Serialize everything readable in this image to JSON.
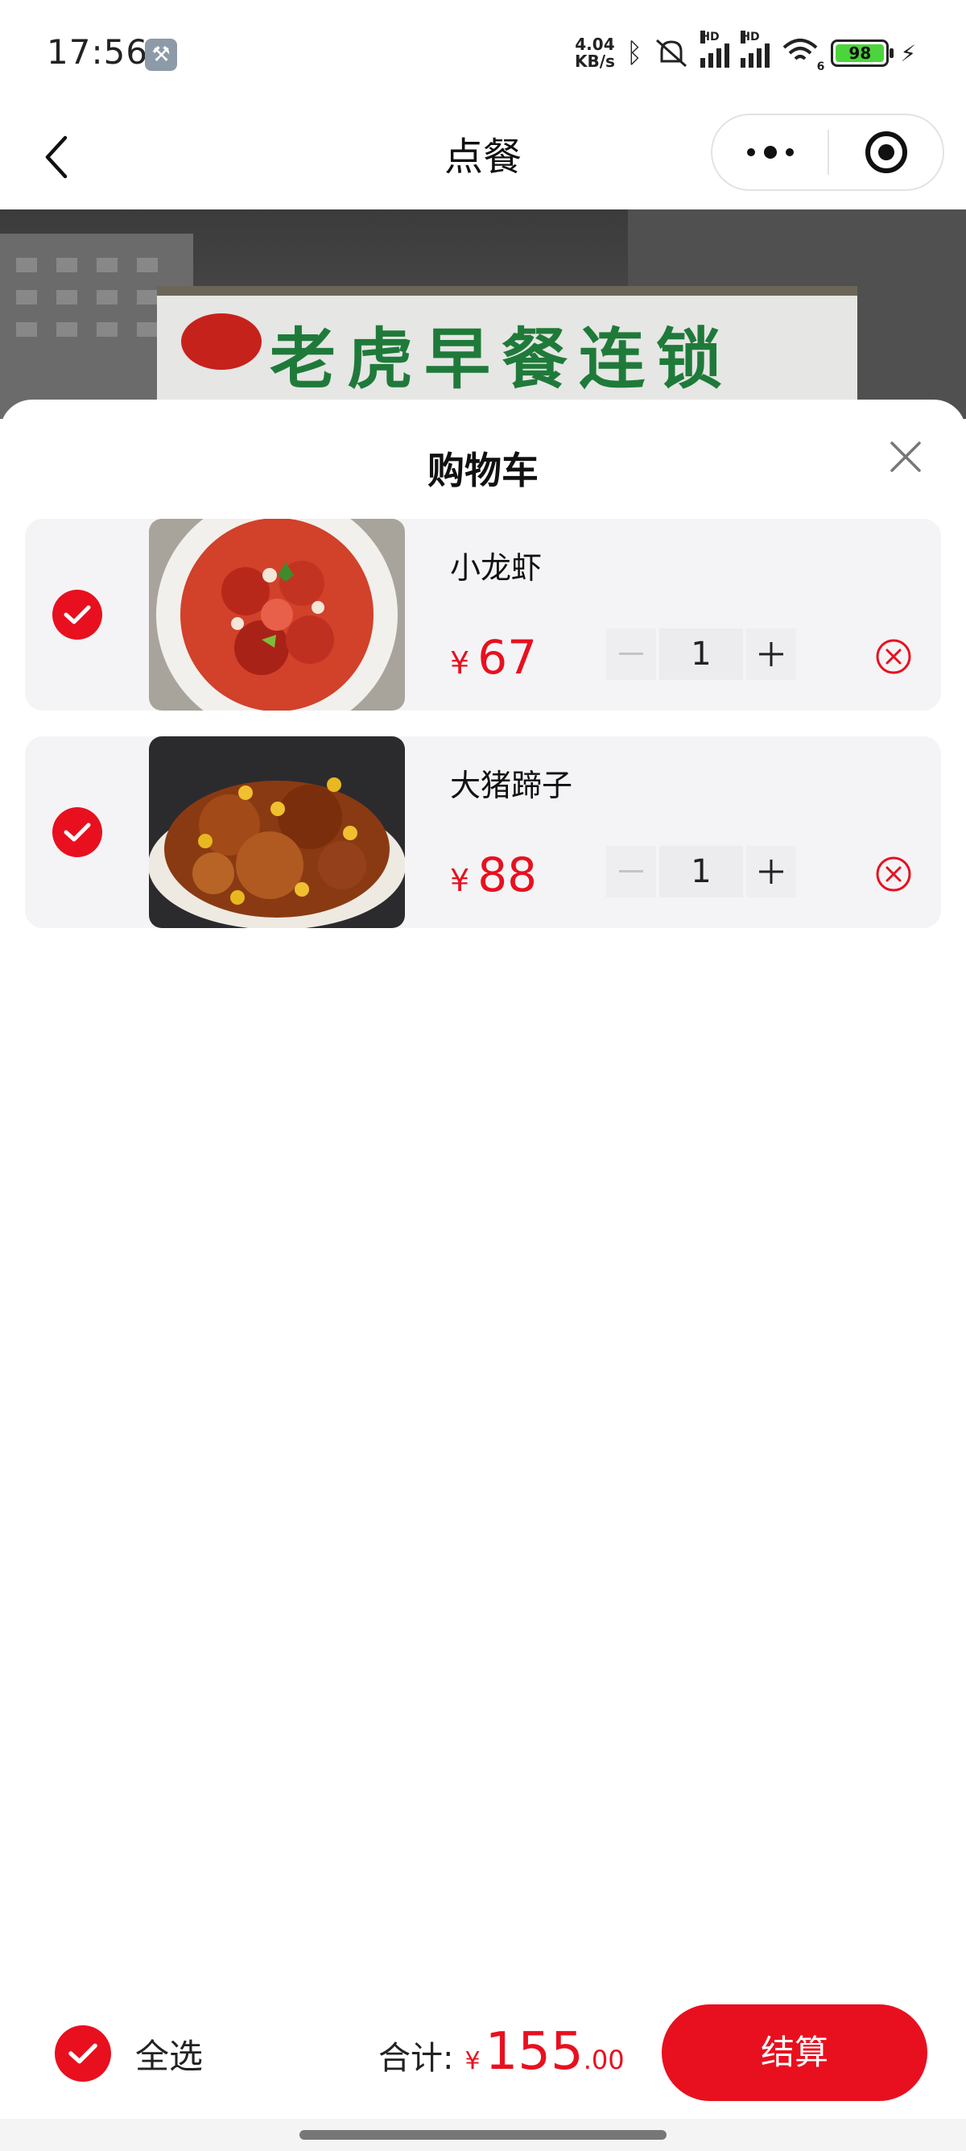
{
  "status_bar": {
    "time": "17:56",
    "net_speed_value": "4.04",
    "net_speed_unit": "KB/s",
    "signal_label": "HD",
    "wifi_label": "6",
    "battery": "98"
  },
  "nav": {
    "title": "点餐"
  },
  "banner": {
    "shop_sign_text": "老虎早餐连锁"
  },
  "cart": {
    "title": "购物车",
    "currency": "¥",
    "items": [
      {
        "name": "小龙虾",
        "price": "67",
        "quantity": "1",
        "selected": true
      },
      {
        "name": "大猪蹄子",
        "price": "88",
        "quantity": "1",
        "selected": true
      }
    ]
  },
  "footer": {
    "select_all_label": "全选",
    "total_label": "合计:",
    "total_currency": "¥",
    "total_integer": "155",
    "total_decimal": ".00",
    "checkout_label": "结算"
  },
  "colors": {
    "accent": "#e8101f",
    "item_bg": "#f4f4f6"
  },
  "icons": {
    "back": "chevron-left-icon",
    "more": "more-dots-icon",
    "target": "target-icon",
    "close": "close-icon",
    "check": "check-icon",
    "minus": "minus-icon",
    "plus": "plus-icon",
    "remove": "remove-circle-icon"
  }
}
